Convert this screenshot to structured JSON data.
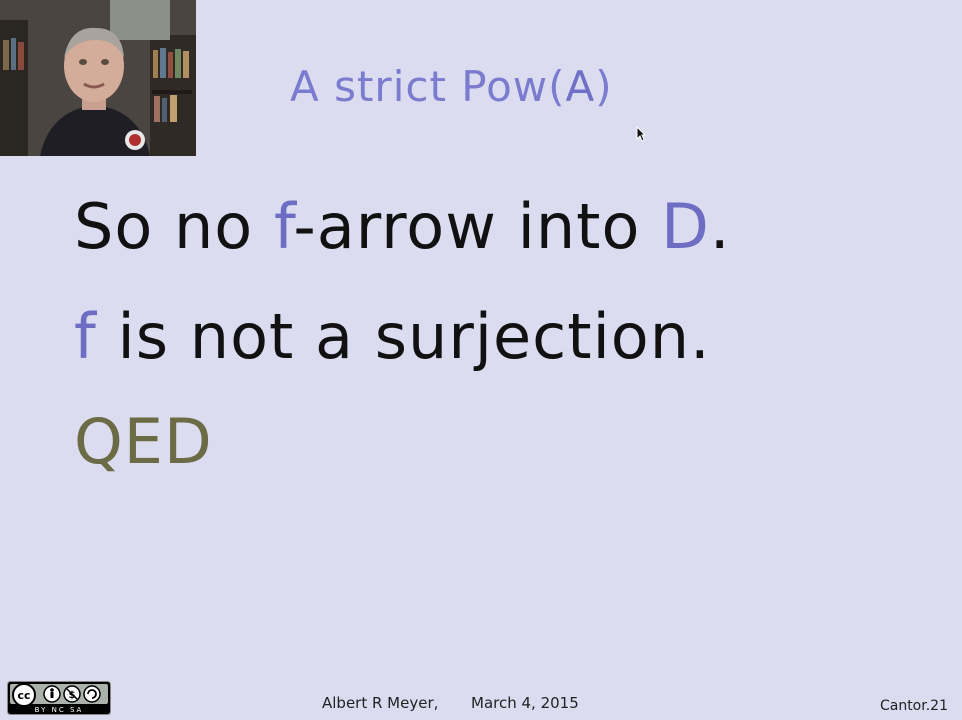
{
  "slide": {
    "title_prefix": "A strict Pow(",
    "title_letter": "A",
    "title_suffix": ")",
    "line1": {
      "part1": "So no ",
      "f": "f",
      "part2": "-arrow into ",
      "d": "D",
      "part3": "."
    },
    "line2": {
      "f": "f",
      "rest": " is not a surjection."
    },
    "line3": "QED"
  },
  "footer": {
    "author": "Albert R Meyer,",
    "date": "March 4, 2015",
    "slide_id": "Cantor.21",
    "license_badge_text": "BY NC SA"
  },
  "colors": {
    "background": "#dcdcf0",
    "title": "#7b7bcf",
    "accent": "#6d6dc4",
    "body_text": "#111111",
    "qed": "#6b6b46"
  }
}
